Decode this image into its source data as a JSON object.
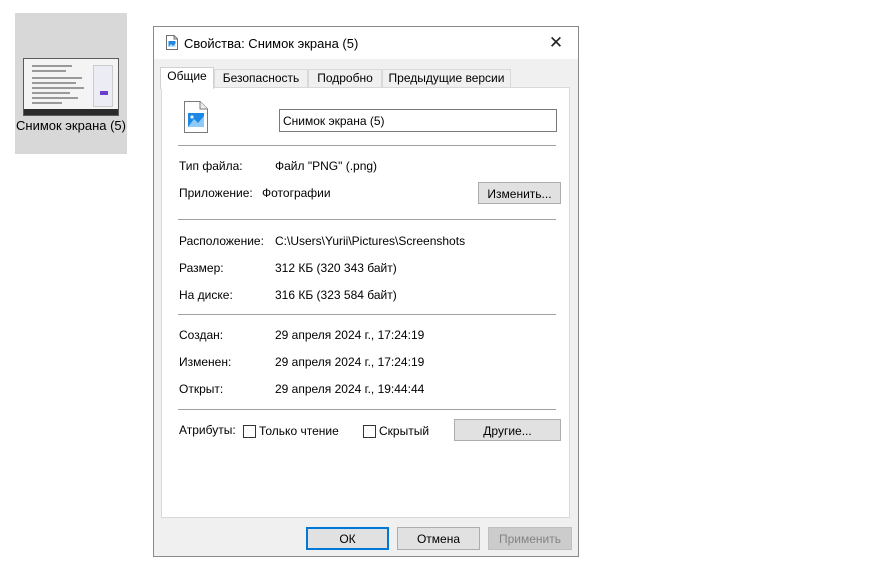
{
  "desktop": {
    "file_label": "Снимок экрана (5)"
  },
  "dialog": {
    "title": "Свойства: Снимок экрана (5)",
    "close_symbol": "✕",
    "tabs": [
      {
        "label": "Общие",
        "active": true
      },
      {
        "label": "Безопасность",
        "active": false
      },
      {
        "label": "Подробно",
        "active": false
      },
      {
        "label": "Предыдущие версии",
        "active": false
      }
    ],
    "general": {
      "file_name": "Снимок экрана (5)",
      "file_type_label": "Тип файла:",
      "file_type_value": "Файл \"PNG\" (.png)",
      "app_label": "Приложение:",
      "app_value": "Фотографии",
      "change_button": "Изменить...",
      "location_label": "Расположение:",
      "location_value": "C:\\Users\\Yurii\\Pictures\\Screenshots",
      "size_label": "Размер:",
      "size_value": "312 КБ (320 343 байт)",
      "disk_label": "На диске:",
      "disk_value": "316 КБ (323 584 байт)",
      "created_label": "Создан:",
      "created_value": "29 апреля 2024 г., 17:24:19",
      "modified_label": "Изменен:",
      "modified_value": "29 апреля 2024 г., 17:24:19",
      "opened_label": "Открыт:",
      "opened_value": "29 апреля 2024 г., 19:44:44",
      "attributes_label": "Атрибуты:",
      "readonly_label": "Только чтение",
      "readonly_checked": false,
      "hidden_label": "Скрытый",
      "hidden_checked": false,
      "other_button": "Другие..."
    },
    "footer": {
      "ok": "ОК",
      "cancel": "Отмена",
      "apply": "Применить"
    }
  },
  "colors": {
    "accent": "#0078d7",
    "dialog_bg": "#f0f0f0",
    "selection_bg": "#d8d8d8"
  }
}
